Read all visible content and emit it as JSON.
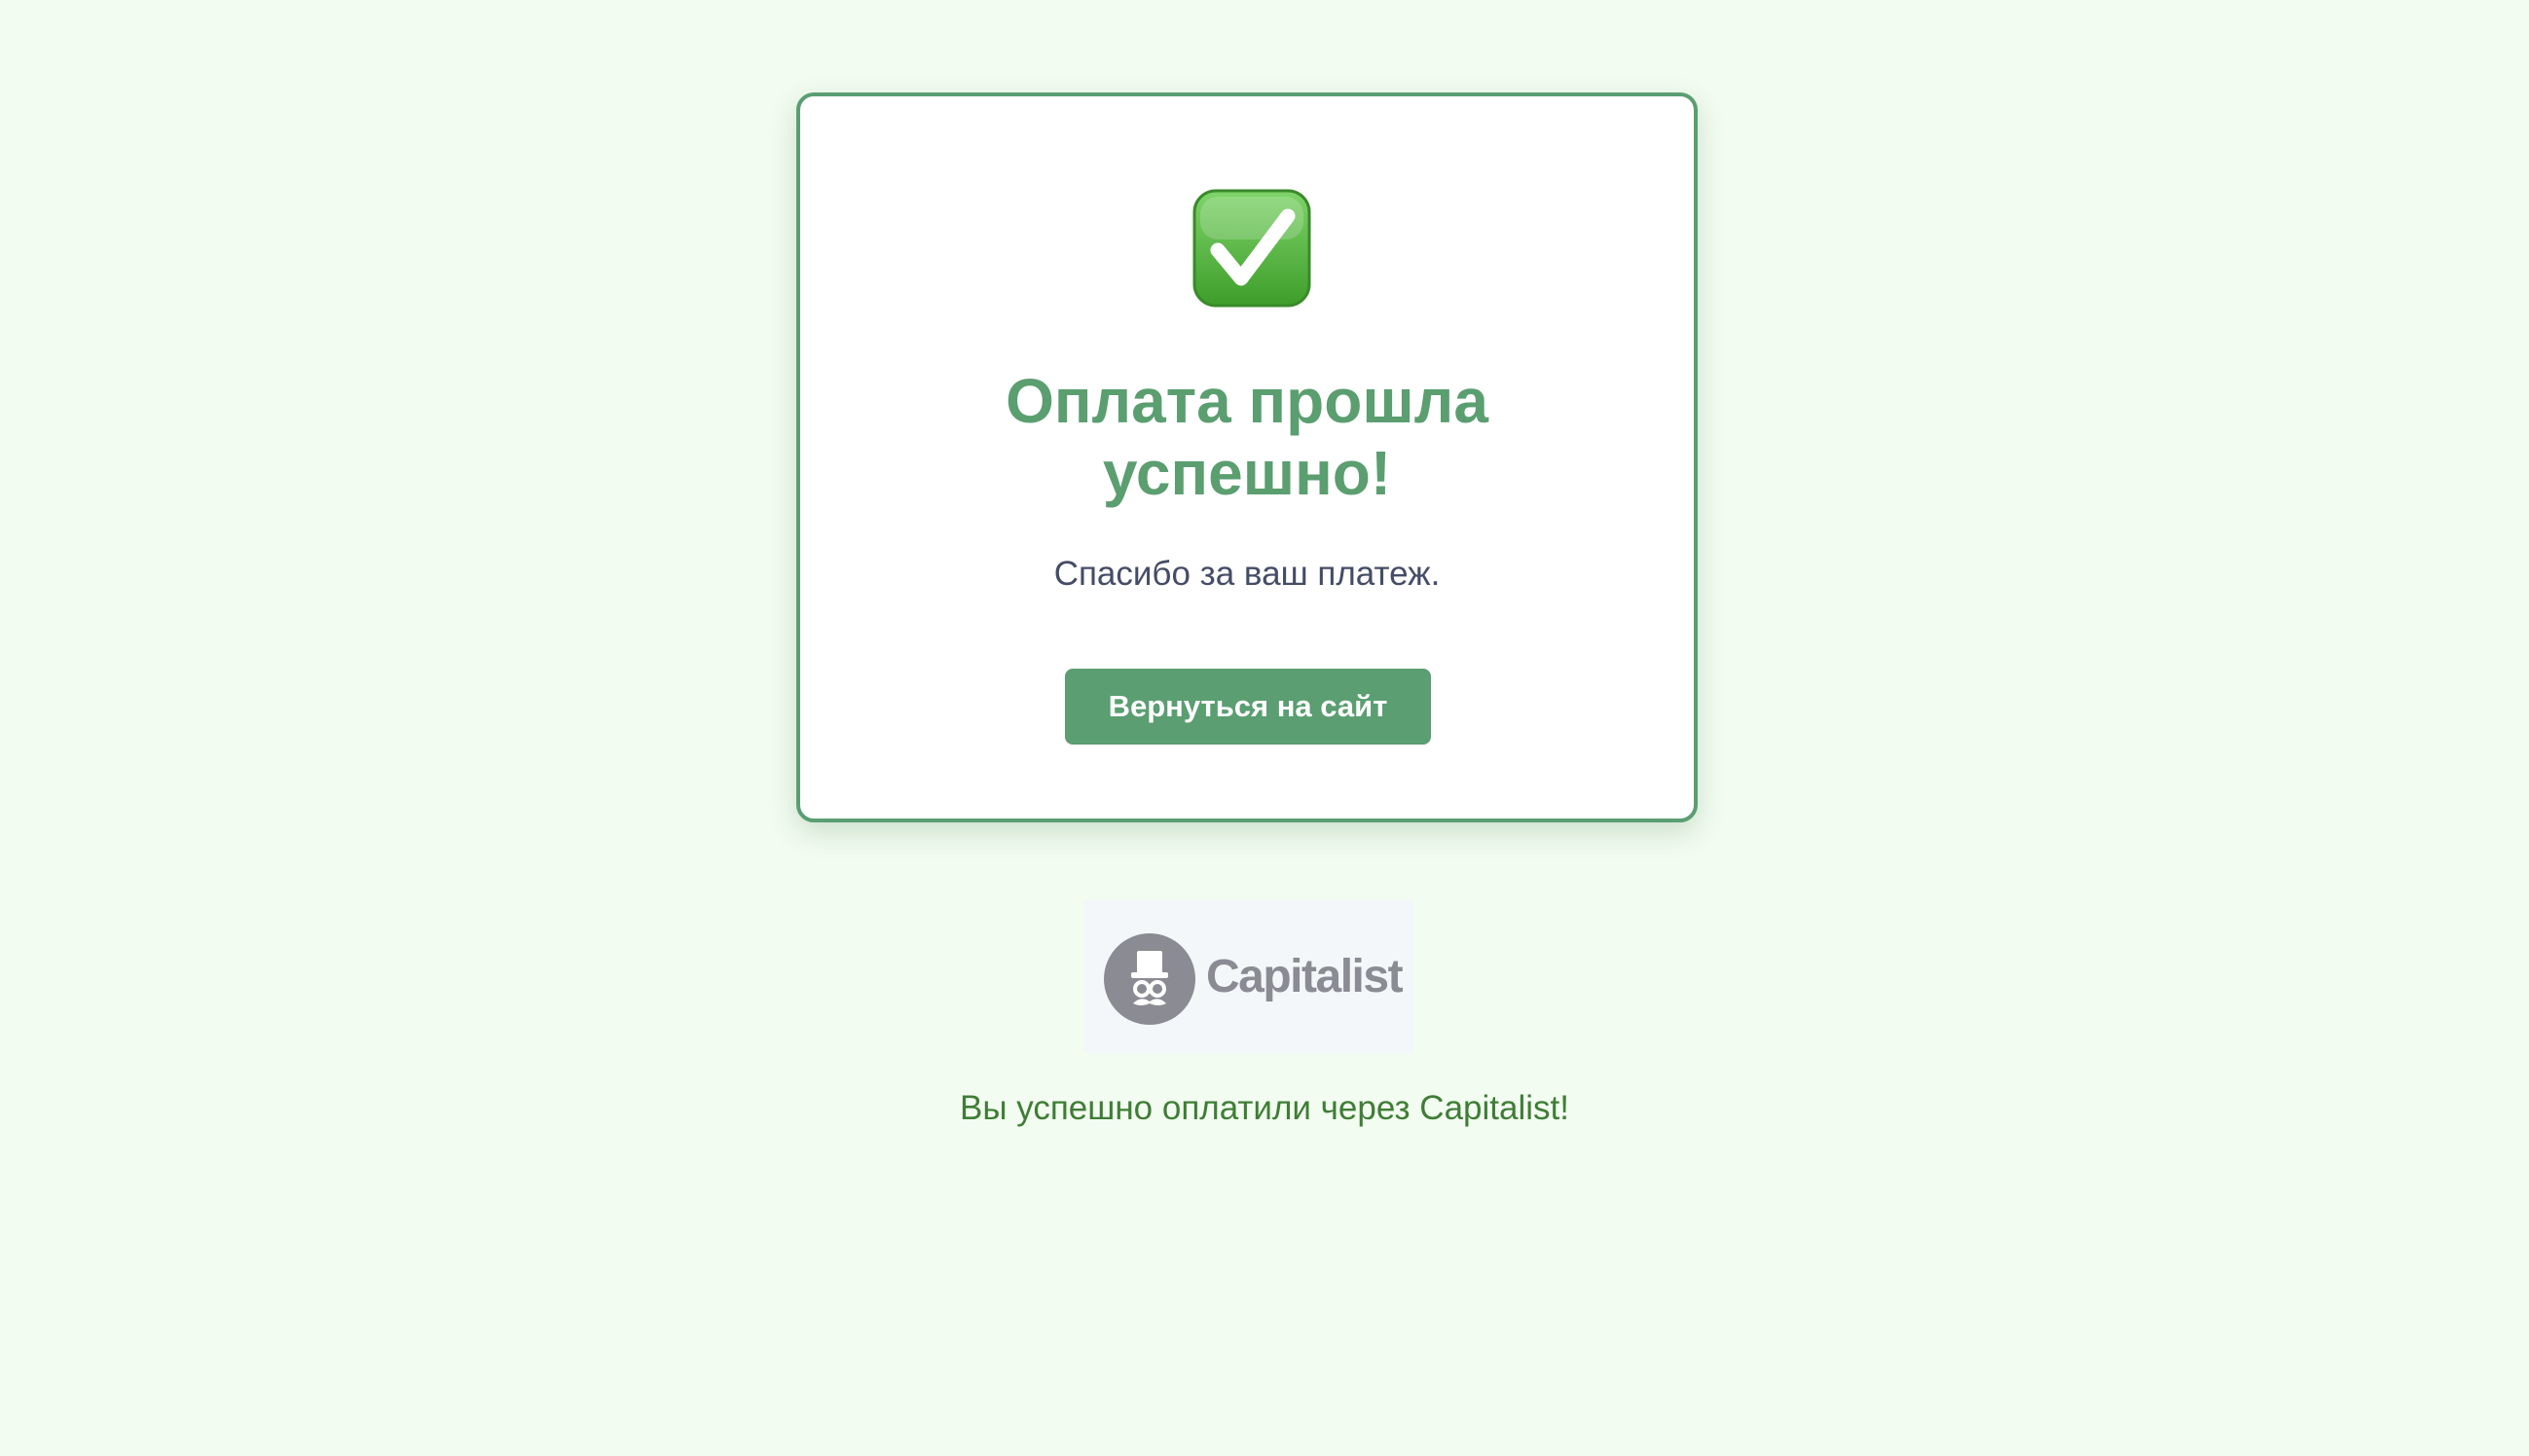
{
  "card": {
    "icon": "check-mark-button-icon",
    "title_line1": "Оплата прошла",
    "title_line2": "успешно!",
    "subtitle": "Спасибо за ваш платеж.",
    "return_button_label": "Вернуться на сайт"
  },
  "logo": {
    "icon": "top-hat-gentleman-icon",
    "text": "Capitalist"
  },
  "footer": {
    "message": "Вы успешно оплатили через Capitalist!"
  },
  "colors": {
    "background": "#f2fcf0",
    "accent_green": "#5a9e71",
    "footer_text": "#3f7d36",
    "body_text": "#454c66",
    "logo_gray": "#8b8b94"
  }
}
